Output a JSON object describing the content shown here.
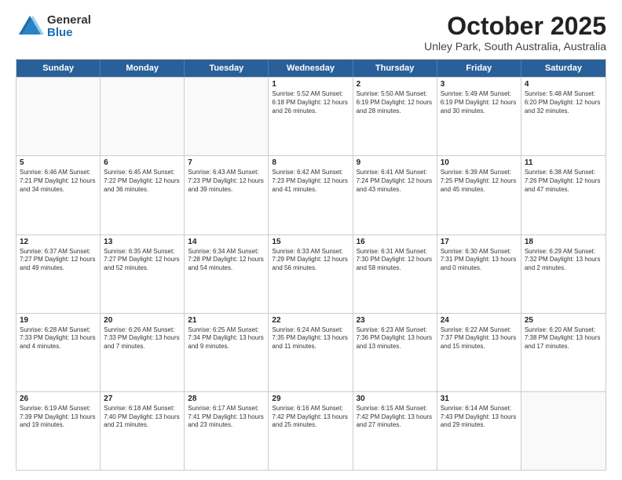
{
  "logo": {
    "general": "General",
    "blue": "Blue"
  },
  "title": "October 2025",
  "location": "Unley Park, South Australia, Australia",
  "header_days": [
    "Sunday",
    "Monday",
    "Tuesday",
    "Wednesday",
    "Thursday",
    "Friday",
    "Saturday"
  ],
  "rows": [
    [
      {
        "day": "",
        "text": "",
        "empty": true
      },
      {
        "day": "",
        "text": "",
        "empty": true
      },
      {
        "day": "",
        "text": "",
        "empty": true
      },
      {
        "day": "1",
        "text": "Sunrise: 5:52 AM\nSunset: 6:18 PM\nDaylight: 12 hours\nand 26 minutes.",
        "empty": false
      },
      {
        "day": "2",
        "text": "Sunrise: 5:50 AM\nSunset: 6:19 PM\nDaylight: 12 hours\nand 28 minutes.",
        "empty": false
      },
      {
        "day": "3",
        "text": "Sunrise: 5:49 AM\nSunset: 6:19 PM\nDaylight: 12 hours\nand 30 minutes.",
        "empty": false
      },
      {
        "day": "4",
        "text": "Sunrise: 5:48 AM\nSunset: 6:20 PM\nDaylight: 12 hours\nand 32 minutes.",
        "empty": false
      }
    ],
    [
      {
        "day": "5",
        "text": "Sunrise: 6:46 AM\nSunset: 7:21 PM\nDaylight: 12 hours\nand 34 minutes.",
        "empty": false
      },
      {
        "day": "6",
        "text": "Sunrise: 6:45 AM\nSunset: 7:22 PM\nDaylight: 12 hours\nand 36 minutes.",
        "empty": false
      },
      {
        "day": "7",
        "text": "Sunrise: 6:43 AM\nSunset: 7:23 PM\nDaylight: 12 hours\nand 39 minutes.",
        "empty": false
      },
      {
        "day": "8",
        "text": "Sunrise: 6:42 AM\nSunset: 7:23 PM\nDaylight: 12 hours\nand 41 minutes.",
        "empty": false
      },
      {
        "day": "9",
        "text": "Sunrise: 6:41 AM\nSunset: 7:24 PM\nDaylight: 12 hours\nand 43 minutes.",
        "empty": false
      },
      {
        "day": "10",
        "text": "Sunrise: 6:39 AM\nSunset: 7:25 PM\nDaylight: 12 hours\nand 45 minutes.",
        "empty": false
      },
      {
        "day": "11",
        "text": "Sunrise: 6:38 AM\nSunset: 7:26 PM\nDaylight: 12 hours\nand 47 minutes.",
        "empty": false
      }
    ],
    [
      {
        "day": "12",
        "text": "Sunrise: 6:37 AM\nSunset: 7:27 PM\nDaylight: 12 hours\nand 49 minutes.",
        "empty": false
      },
      {
        "day": "13",
        "text": "Sunrise: 6:35 AM\nSunset: 7:27 PM\nDaylight: 12 hours\nand 52 minutes.",
        "empty": false
      },
      {
        "day": "14",
        "text": "Sunrise: 6:34 AM\nSunset: 7:28 PM\nDaylight: 12 hours\nand 54 minutes.",
        "empty": false
      },
      {
        "day": "15",
        "text": "Sunrise: 6:33 AM\nSunset: 7:29 PM\nDaylight: 12 hours\nand 56 minutes.",
        "empty": false
      },
      {
        "day": "16",
        "text": "Sunrise: 6:31 AM\nSunset: 7:30 PM\nDaylight: 12 hours\nand 58 minutes.",
        "empty": false
      },
      {
        "day": "17",
        "text": "Sunrise: 6:30 AM\nSunset: 7:31 PM\nDaylight: 13 hours\nand 0 minutes.",
        "empty": false
      },
      {
        "day": "18",
        "text": "Sunrise: 6:29 AM\nSunset: 7:32 PM\nDaylight: 13 hours\nand 2 minutes.",
        "empty": false
      }
    ],
    [
      {
        "day": "19",
        "text": "Sunrise: 6:28 AM\nSunset: 7:33 PM\nDaylight: 13 hours\nand 4 minutes.",
        "empty": false
      },
      {
        "day": "20",
        "text": "Sunrise: 6:26 AM\nSunset: 7:33 PM\nDaylight: 13 hours\nand 7 minutes.",
        "empty": false
      },
      {
        "day": "21",
        "text": "Sunrise: 6:25 AM\nSunset: 7:34 PM\nDaylight: 13 hours\nand 9 minutes.",
        "empty": false
      },
      {
        "day": "22",
        "text": "Sunrise: 6:24 AM\nSunset: 7:35 PM\nDaylight: 13 hours\nand 11 minutes.",
        "empty": false
      },
      {
        "day": "23",
        "text": "Sunrise: 6:23 AM\nSunset: 7:36 PM\nDaylight: 13 hours\nand 13 minutes.",
        "empty": false
      },
      {
        "day": "24",
        "text": "Sunrise: 6:22 AM\nSunset: 7:37 PM\nDaylight: 13 hours\nand 15 minutes.",
        "empty": false
      },
      {
        "day": "25",
        "text": "Sunrise: 6:20 AM\nSunset: 7:38 PM\nDaylight: 13 hours\nand 17 minutes.",
        "empty": false
      }
    ],
    [
      {
        "day": "26",
        "text": "Sunrise: 6:19 AM\nSunset: 7:39 PM\nDaylight: 13 hours\nand 19 minutes.",
        "empty": false
      },
      {
        "day": "27",
        "text": "Sunrise: 6:18 AM\nSunset: 7:40 PM\nDaylight: 13 hours\nand 21 minutes.",
        "empty": false
      },
      {
        "day": "28",
        "text": "Sunrise: 6:17 AM\nSunset: 7:41 PM\nDaylight: 13 hours\nand 23 minutes.",
        "empty": false
      },
      {
        "day": "29",
        "text": "Sunrise: 6:16 AM\nSunset: 7:42 PM\nDaylight: 13 hours\nand 25 minutes.",
        "empty": false
      },
      {
        "day": "30",
        "text": "Sunrise: 6:15 AM\nSunset: 7:42 PM\nDaylight: 13 hours\nand 27 minutes.",
        "empty": false
      },
      {
        "day": "31",
        "text": "Sunrise: 6:14 AM\nSunset: 7:43 PM\nDaylight: 13 hours\nand 29 minutes.",
        "empty": false
      },
      {
        "day": "",
        "text": "",
        "empty": true
      }
    ]
  ]
}
